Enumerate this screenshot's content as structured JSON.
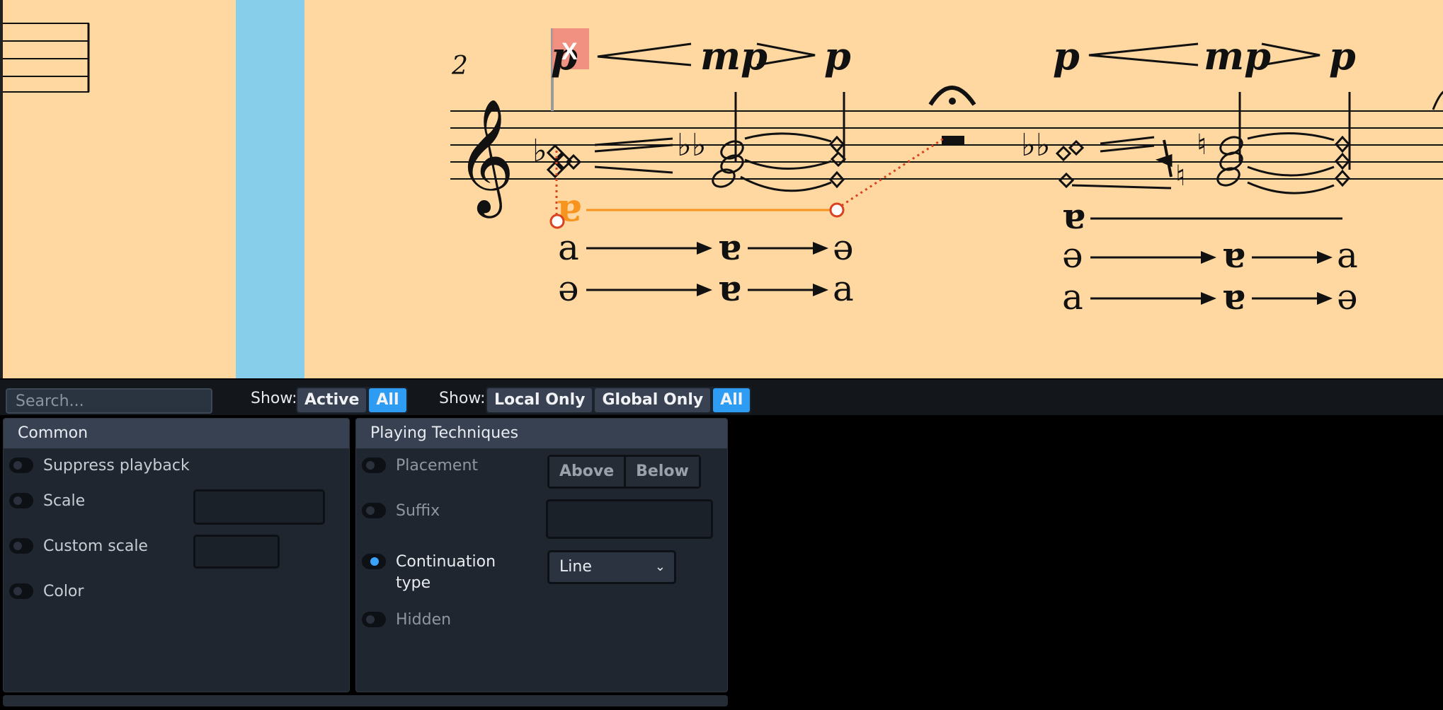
{
  "score": {
    "bar_number": "2",
    "dynamics_1": {
      "start": "p",
      "middle": "mp",
      "end": "p"
    },
    "dynamics_2": {
      "start": "p",
      "middle": "mp",
      "end": "p"
    },
    "selected_technique": "ɐ",
    "delete_marker": "X",
    "vowel_rows_1": [
      [
        "a",
        "ɐ",
        "ə"
      ],
      [
        "ə",
        "ɐ",
        "a"
      ]
    ],
    "vowel_rows_2": [
      [
        "ɐ"
      ],
      [
        "ə",
        "ɐ",
        "a"
      ],
      [
        "a",
        "ɐ",
        "ə"
      ]
    ],
    "colors": {
      "page": "#fed8a0",
      "selection": "#f7931e",
      "handle": "#d9411f",
      "playhead": "#87ceeb"
    }
  },
  "toolbar": {
    "search_placeholder": "Search...",
    "show_label_1": "Show:",
    "active_label": "Active",
    "all_label_1": "All",
    "show_label_2": "Show:",
    "local_only_label": "Local Only",
    "global_only_label": "Global Only",
    "all_label_2": "All"
  },
  "common": {
    "title": "Common",
    "suppress_playback": "Suppress playback",
    "scale": "Scale",
    "custom_scale": "Custom scale",
    "color": "Color"
  },
  "techniques": {
    "title": "Playing Techniques",
    "placement": "Placement",
    "above": "Above",
    "below": "Below",
    "suffix": "Suffix",
    "continuation_type_1": "Continuation",
    "continuation_type_2": "type",
    "continuation_value": "Line",
    "hidden": "Hidden"
  }
}
